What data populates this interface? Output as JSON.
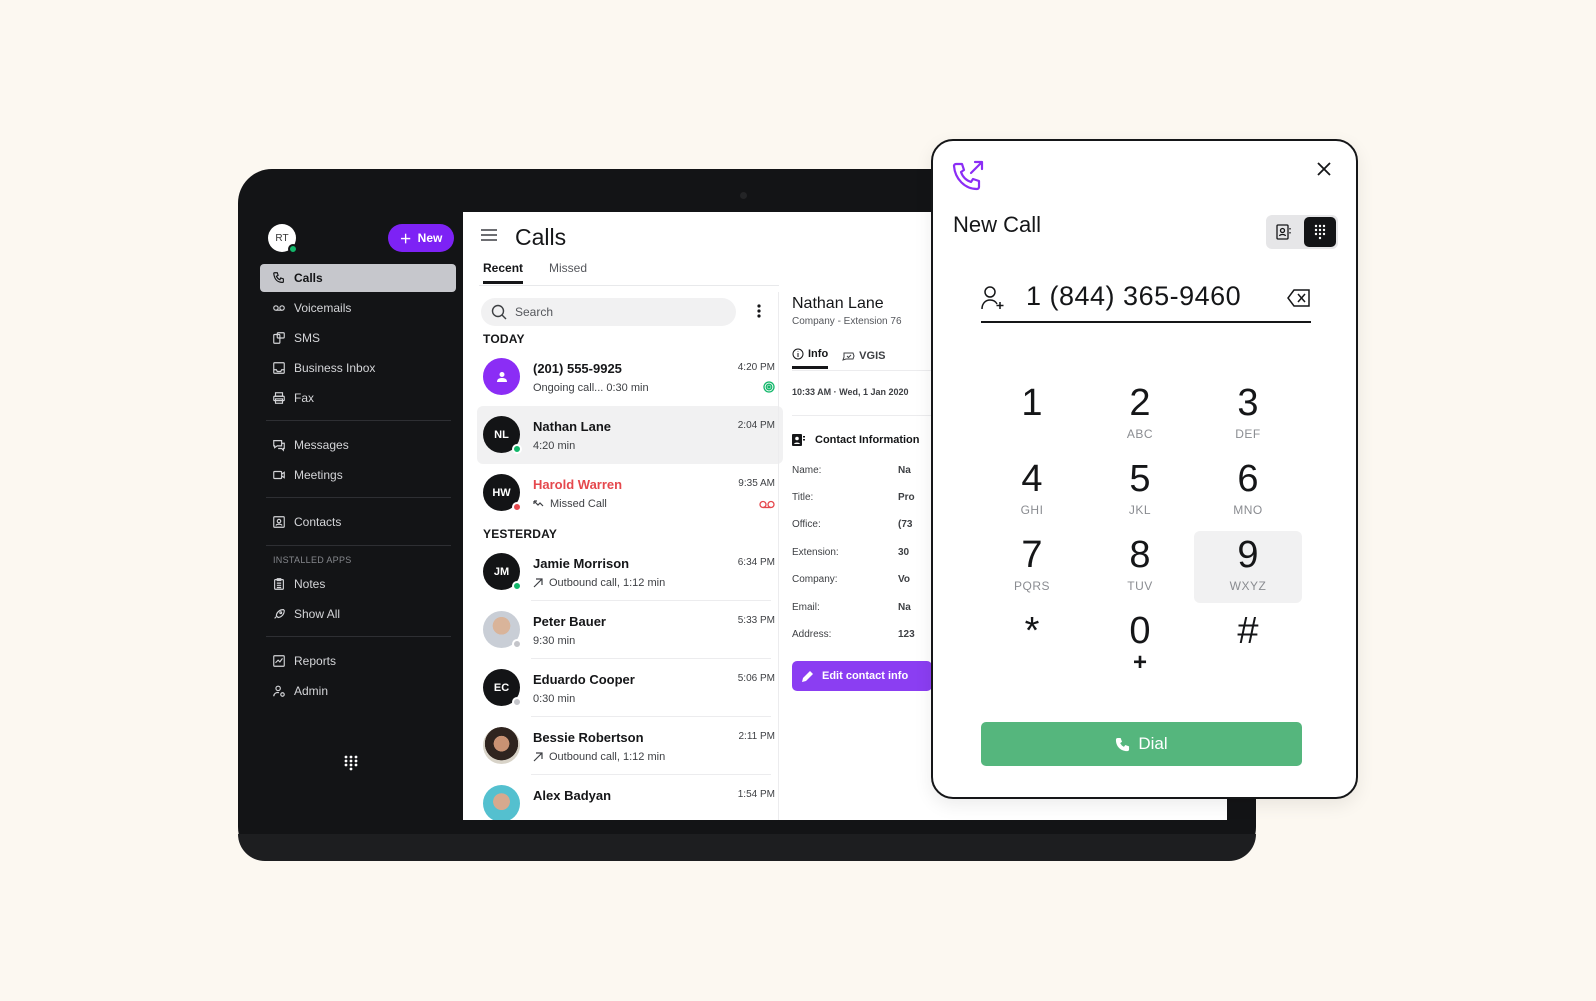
{
  "sidebar": {
    "user_initials": "RT",
    "new_button": "New",
    "items": [
      {
        "label": "Calls",
        "icon": "phone-icon",
        "active": true
      },
      {
        "label": "Voicemails",
        "icon": "voicemail-icon"
      },
      {
        "label": "SMS",
        "icon": "sms-icon"
      },
      {
        "label": "Business Inbox",
        "icon": "inbox-icon"
      },
      {
        "label": "Fax",
        "icon": "printer-icon"
      },
      {
        "label": "Messages",
        "icon": "chat-icon"
      },
      {
        "label": "Meetings",
        "icon": "video-icon"
      },
      {
        "label": "Contacts",
        "icon": "contact-card-icon"
      },
      {
        "label": "Notes",
        "icon": "clipboard-icon"
      },
      {
        "label": "Show All",
        "icon": "rocket-icon"
      },
      {
        "label": "Reports",
        "icon": "chart-icon"
      },
      {
        "label": "Admin",
        "icon": "admin-user-icon"
      }
    ],
    "section_installed_apps": "INSTALLED APPS"
  },
  "calls": {
    "title": "Calls",
    "tabs": [
      "Recent",
      "Missed"
    ],
    "active_tab": "Recent",
    "search_placeholder": "Search",
    "groups": {
      "today": "TODAY",
      "yesterday": "YESTERDAY"
    },
    "rows": [
      {
        "name": "(201) 555-9925",
        "sub": "Ongoing call... 0:30 min",
        "time": "4:20 PM",
        "initials": "",
        "avatar": "purple-person",
        "badge": "ongoing-call-icon"
      },
      {
        "name": "Nathan Lane",
        "sub": "4:20 min",
        "time": "2:04 PM",
        "initials": "NL",
        "status": "online",
        "selected": true
      },
      {
        "name": "Harold Warren",
        "sub": "Missed Call",
        "time": "9:35 AM",
        "initials": "HW",
        "status": "busy",
        "missed": true,
        "badge": "voicemail-icon"
      },
      {
        "name": "Jamie Morrison",
        "sub": "Outbound call, 1:12 min",
        "time": "6:34 PM",
        "initials": "JM",
        "status": "online",
        "direction": "outbound"
      },
      {
        "name": "Peter Bauer",
        "sub": "9:30 min",
        "time": "5:33 PM",
        "avatar": "photo",
        "status": "offline"
      },
      {
        "name": "Eduardo Cooper",
        "sub": "0:30 min",
        "time": "5:06 PM",
        "initials": "EC",
        "status": "offline"
      },
      {
        "name": "Bessie Robertson",
        "sub": "Outbound call, 1:12 min",
        "time": "2:11 PM",
        "avatar": "photo",
        "direction": "outbound"
      },
      {
        "name": "Alex Badyan",
        "sub": "",
        "time": "1:54 PM",
        "avatar": "photo"
      }
    ]
  },
  "contact": {
    "name": "Nathan Lane",
    "subtitle": "Company -  Extension 76",
    "tabs": [
      "Info",
      "VGIS"
    ],
    "active_tab": "Info",
    "datetime": "10:33 AM  ·  Wed, 1 Jan 2020",
    "section_title": "Contact Information",
    "fields": [
      {
        "label": "Name:",
        "value": "Na"
      },
      {
        "label": "Title:",
        "value": "Pro"
      },
      {
        "label": "Office:",
        "value": "(73"
      },
      {
        "label": "Extension:",
        "value": "30"
      },
      {
        "label": "Company:",
        "value": "Vo"
      },
      {
        "label": "Email:",
        "value": "Na"
      },
      {
        "label": "Address:",
        "value": "123"
      }
    ],
    "edit_button": "Edit contact info"
  },
  "dialer": {
    "title": "New Call",
    "number": "1 (844) 365-9460",
    "mode": "keypad",
    "keys": [
      {
        "digit": "1",
        "letters": ""
      },
      {
        "digit": "2",
        "letters": "ABC"
      },
      {
        "digit": "3",
        "letters": "DEF"
      },
      {
        "digit": "4",
        "letters": "GHI"
      },
      {
        "digit": "5",
        "letters": "JKL"
      },
      {
        "digit": "6",
        "letters": "MNO"
      },
      {
        "digit": "7",
        "letters": "PQRS"
      },
      {
        "digit": "8",
        "letters": "TUV"
      },
      {
        "digit": "9",
        "letters": "WXYZ",
        "highlighted": true
      },
      {
        "digit": "*",
        "letters": ""
      },
      {
        "digit": "0",
        "letters": "+"
      },
      {
        "digit": "#",
        "letters": ""
      }
    ],
    "dial_button": "Dial"
  },
  "colors": {
    "brand_purple": "#7d22f5",
    "dial_green": "#55b67d",
    "missed_red": "#e5484d",
    "online_green": "#12b76a"
  }
}
